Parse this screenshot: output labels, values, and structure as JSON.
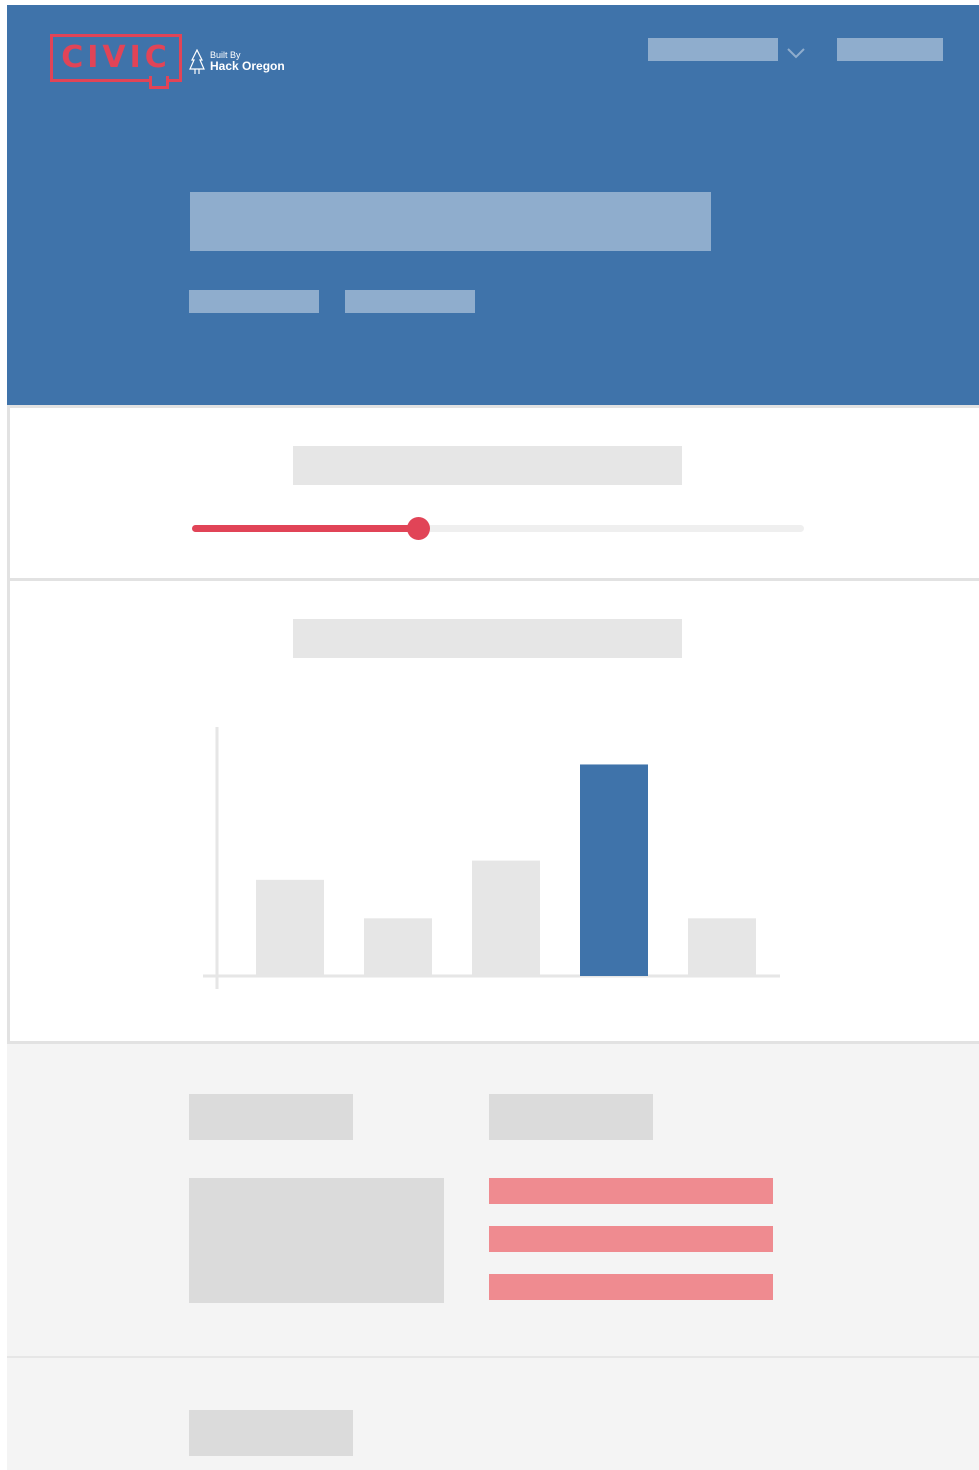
{
  "colors": {
    "hero_background": "#3f73aa",
    "hero_placeholder": "#8fadcd",
    "accent": "#e14457",
    "placeholder_gray": "#e6e6e6",
    "placeholder_gray_dark": "#dbdbdb",
    "highlight_bar": "#3f73aa",
    "pink_row": "#ef8b90",
    "footer_background": "#f4f4f4"
  },
  "header": {
    "logo_text": "CIVIC",
    "built_by": "Built By",
    "org_name": "Hack Oregon",
    "tree_icon": "tree-icon",
    "dropdown_icon": "chevron-down-icon"
  },
  "slider": {
    "value_fraction": 0.37
  },
  "chart_data": {
    "type": "bar",
    "categories": [
      "",
      "",
      "",
      "",
      ""
    ],
    "values": [
      5,
      3,
      6,
      11,
      3
    ],
    "highlighted_index": 3,
    "ylim": [
      0,
      13
    ],
    "title": "",
    "xlabel": "",
    "ylabel": ""
  }
}
